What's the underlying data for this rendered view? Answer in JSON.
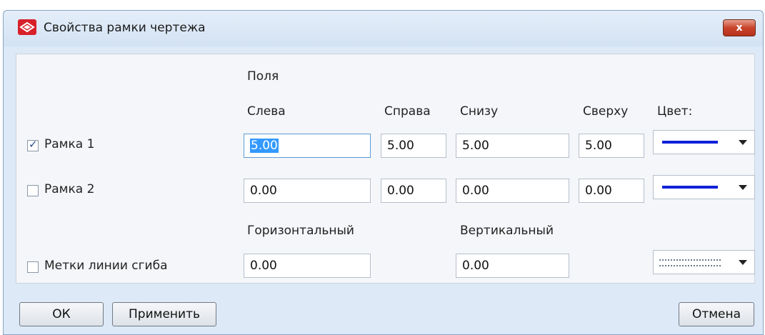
{
  "window": {
    "title": "Свойства рамки чертежа",
    "close_label": "x"
  },
  "section": {
    "fields_header": "Поля"
  },
  "columns": {
    "left": "Слева",
    "right": "Справа",
    "bottom": "Снизу",
    "top": "Сверху",
    "color": "Цвет:"
  },
  "rows": [
    {
      "label": "Рамка 1",
      "checked": true,
      "left": "5.00",
      "right": "5.00",
      "bottom": "5.00",
      "top": "5.00",
      "color": "#1020d8"
    },
    {
      "label": "Рамка 2",
      "checked": false,
      "left": "0.00",
      "right": "0.00",
      "bottom": "0.00",
      "top": "0.00",
      "color": "#1020d8"
    }
  ],
  "fold": {
    "horizontal_header": "Горизонтальный",
    "vertical_header": "Вертикальный",
    "label": "Метки линии сгиба",
    "checked": false,
    "horizontal": "0.00",
    "vertical": "0.00"
  },
  "buttons": {
    "ok": "ОК",
    "apply": "Применить",
    "cancel": "Отмена"
  }
}
